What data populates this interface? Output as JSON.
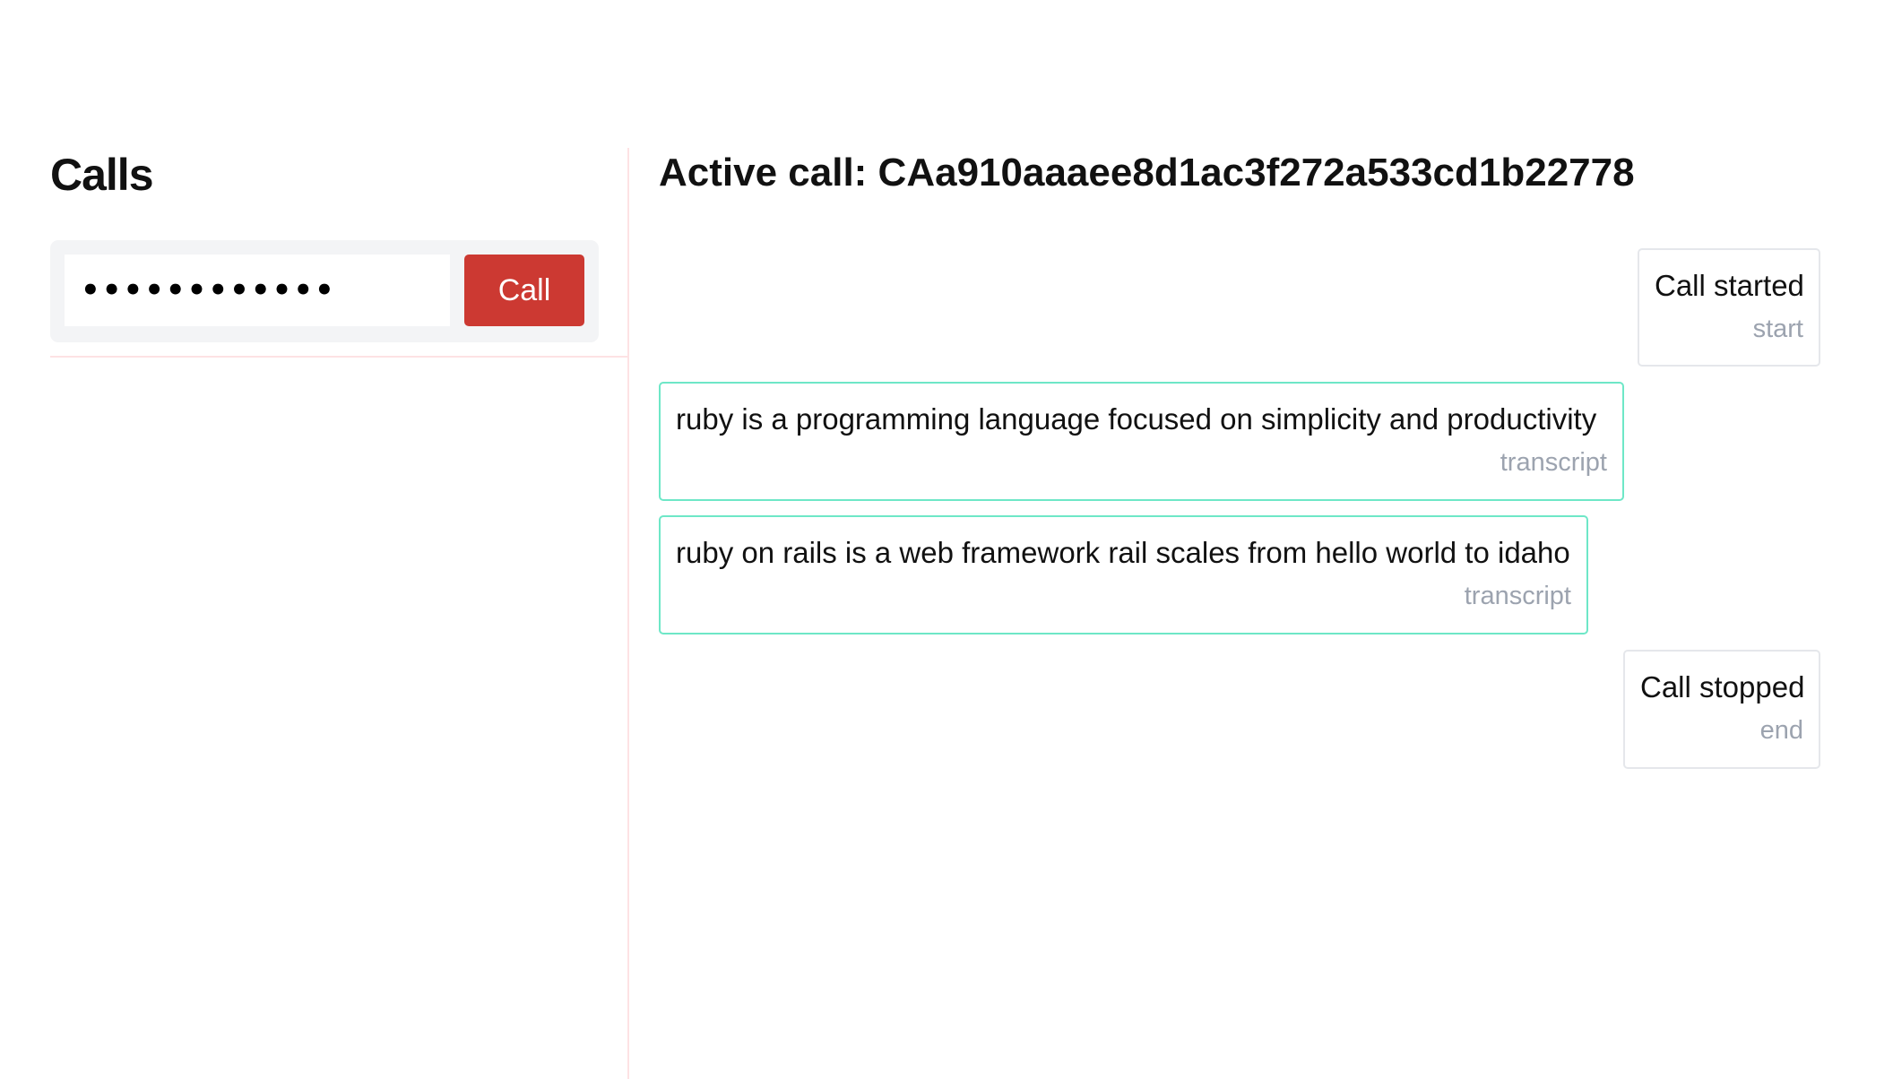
{
  "calls_panel": {
    "title": "Calls",
    "phone_input_value": "••••••••••••",
    "call_button_label": "Call",
    "accent_color": "#cc3932"
  },
  "active_call": {
    "title": "Active call: CAa910aaaee8d1ac3f272a533cd1b22778",
    "messages": [
      {
        "text": "Call started",
        "tag": "start",
        "kind": "event"
      },
      {
        "text": "ruby is a programming language focused on simplicity and productivity",
        "tag": "transcript",
        "kind": "transcript"
      },
      {
        "text": "ruby on rails is a web framework rail scales from hello world to idaho",
        "tag": "transcript",
        "kind": "transcript"
      },
      {
        "text": "Call stopped",
        "tag": "end",
        "kind": "event"
      }
    ],
    "transcript_border_color": "#6ee7c7",
    "event_border_color": "#e5e7eb"
  }
}
